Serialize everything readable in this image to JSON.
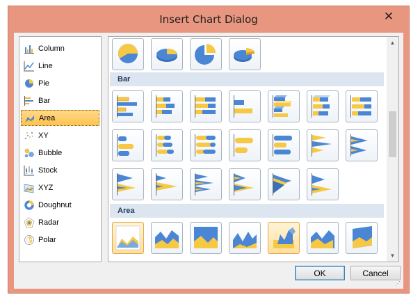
{
  "window": {
    "title": "Insert Chart Dialog"
  },
  "sidebar": {
    "items": [
      {
        "label": "Column",
        "icon": "column-chart-icon"
      },
      {
        "label": "Line",
        "icon": "line-chart-icon"
      },
      {
        "label": "Pie",
        "icon": "pie-chart-icon"
      },
      {
        "label": "Bar",
        "icon": "bar-chart-icon"
      },
      {
        "label": "Area",
        "icon": "area-chart-icon",
        "selected": true
      },
      {
        "label": "XY",
        "icon": "xy-chart-icon"
      },
      {
        "label": "Bubble",
        "icon": "bubble-chart-icon"
      },
      {
        "label": "Stock",
        "icon": "stock-chart-icon"
      },
      {
        "label": "XYZ",
        "icon": "xyz-chart-icon"
      },
      {
        "label": "Doughnut",
        "icon": "doughnut-chart-icon"
      },
      {
        "label": "Radar",
        "icon": "radar-chart-icon"
      },
      {
        "label": "Polar",
        "icon": "polar-chart-icon"
      }
    ]
  },
  "gallery": {
    "groups": [
      {
        "title": "Bar"
      },
      {
        "title": "Area"
      }
    ]
  },
  "buttons": {
    "ok": "OK",
    "cancel": "Cancel"
  },
  "colors": {
    "accent_blue": "#4a86d4",
    "accent_yellow": "#f7c843",
    "title_bar": "#e8967f"
  }
}
